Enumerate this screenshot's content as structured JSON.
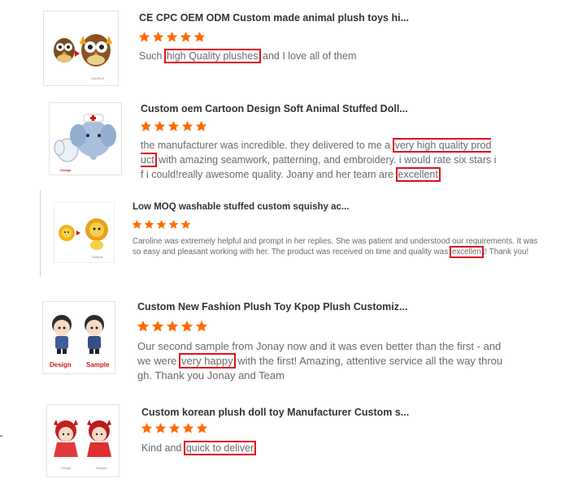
{
  "reviews": [
    {
      "title": "CE CPC OEM ODM Custom made animal plush toys hi...",
      "text_parts": [
        {
          "t": "Such ",
          "hl": false
        },
        {
          "t": "high Quality plushes",
          "hl": true
        },
        {
          "t": " and I love all of them",
          "hl": false
        }
      ],
      "thumb_captions": [
        "SAMPLE"
      ]
    },
    {
      "title": "Custom oem Cartoon Design Soft Animal Stuffed Doll...",
      "text_parts": [
        {
          "t": "the manufacturer was incredible. they delivered to me a ",
          "hl": false
        },
        {
          "t": "very high quality product",
          "hl": true
        },
        {
          "t": " with amazing seamwork, patterning, and embroidery. i would rate six stars if i could!really awesome quality. Joany and her team are ",
          "hl": false
        },
        {
          "t": "excellent",
          "hl": true
        }
      ],
      "thumb_captions": [
        "Design",
        "Sample"
      ]
    },
    {
      "title": "Low MOQ washable stuffed custom squishy ac...",
      "text_parts": [
        {
          "t": "Caroline was extremely helpful and prompt in her replies. She was patient and understood our requirements. It was so easy and pleasant working with her. The product was received on time and quality was ",
          "hl": false
        },
        {
          "t": "excellen",
          "hl": true
        },
        {
          "t": "t! Thank you!",
          "hl": false
        }
      ],
      "thumb_captions": [
        "Sample"
      ]
    },
    {
      "title": "Custom New Fashion Plush Toy Kpop Plush Customiz...",
      "text_parts": [
        {
          "t": "Our second sample from Jonay now and it was even better than the first - and we were ",
          "hl": false
        },
        {
          "t": "very happy",
          "hl": true
        },
        {
          "t": " with the first! Amazing, attentive service all the way through. Thank you Jonay and Team",
          "hl": false
        }
      ],
      "thumb_captions": [
        "Design",
        "Sample"
      ]
    },
    {
      "title": "Custom korean plush doll toy Manufacturer Custom s...",
      "text_parts": [
        {
          "t": "Kind and ",
          "hl": false
        },
        {
          "t": "quick to deliver",
          "hl": true
        }
      ],
      "thumb_captions": [
        "Design",
        "Sample"
      ]
    }
  ],
  "rating": {
    "stars": 5,
    "max": 5
  },
  "colors": {
    "star": "#ff6a00",
    "highlight_border": "#e0101e",
    "title": "#333333",
    "body_text": "#6a6a6a"
  },
  "icons": {
    "star": "star-icon"
  }
}
